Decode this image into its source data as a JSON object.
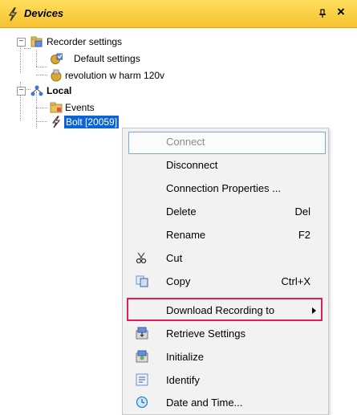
{
  "panel": {
    "title": "Devices",
    "pin_glyph": "→",
    "close_glyph": "×"
  },
  "tree": {
    "recorder_settings": "Recorder settings",
    "default_settings": "Default settings",
    "revolution": "revolution w harm 120v",
    "local": "Local",
    "events": "Events",
    "bolt": "Bolt [20059]"
  },
  "menu": {
    "items": [
      {
        "label": "Connect",
        "shortcut": "",
        "enabled": false,
        "icon": ""
      },
      {
        "label": "Disconnect",
        "shortcut": "",
        "enabled": true,
        "icon": ""
      },
      {
        "label": "Connection Properties ...",
        "shortcut": "",
        "enabled": true,
        "icon": ""
      },
      {
        "label": "Delete",
        "shortcut": "Del",
        "enabled": true,
        "icon": ""
      },
      {
        "label": "Rename",
        "shortcut": "F2",
        "enabled": true,
        "icon": ""
      },
      {
        "label": "Cut",
        "shortcut": "",
        "enabled": true,
        "icon": "scissors-icon"
      },
      {
        "label": "Copy",
        "shortcut": "Ctrl+X",
        "enabled": true,
        "icon": "copy-icon"
      },
      {
        "label": "Download Recording to",
        "shortcut": "",
        "enabled": true,
        "icon": "",
        "submenu": true,
        "highlighted": true
      },
      {
        "label": "Retrieve Settings",
        "shortcut": "",
        "enabled": true,
        "icon": "retrieve-settings-icon"
      },
      {
        "label": "Initialize",
        "shortcut": "",
        "enabled": true,
        "icon": "initialize-icon"
      },
      {
        "label": "Identify",
        "shortcut": "",
        "enabled": true,
        "icon": "identify-icon"
      },
      {
        "label": "Date and Time...",
        "shortcut": "",
        "enabled": true,
        "icon": "clock-icon"
      }
    ]
  },
  "colors": {
    "title_bar": "#f5c230",
    "selection": "#0a64d4",
    "highlight_border": "#e01e5a"
  }
}
